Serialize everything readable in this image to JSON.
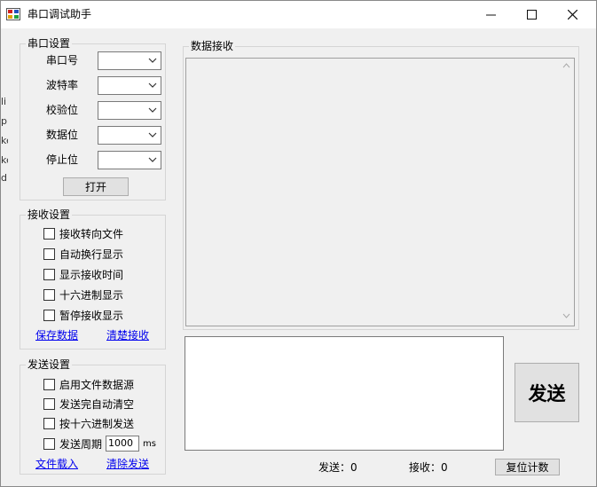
{
  "window": {
    "title": "串口调试助手",
    "minimize_icon": "minimize-icon",
    "maximize_icon": "maximize-icon",
    "close_icon": "close-icon"
  },
  "serial_settings": {
    "title": "串口设置",
    "fields": [
      {
        "label": "串口号",
        "value": ""
      },
      {
        "label": "波特率",
        "value": ""
      },
      {
        "label": "校验位",
        "value": ""
      },
      {
        "label": "数据位",
        "value": ""
      },
      {
        "label": "停止位",
        "value": ""
      }
    ],
    "open_button": "打开"
  },
  "receive_settings": {
    "title": "接收设置",
    "options": [
      {
        "label": "接收转向文件",
        "checked": false
      },
      {
        "label": "自动换行显示",
        "checked": false
      },
      {
        "label": "显示接收时间",
        "checked": false
      },
      {
        "label": "十六进制显示",
        "checked": false
      },
      {
        "label": "暂停接收显示",
        "checked": false
      }
    ],
    "save_data": "保存数据",
    "clear_receive": "清楚接收"
  },
  "send_settings": {
    "title": "发送设置",
    "options": [
      {
        "label": "启用文件数据源",
        "checked": false
      },
      {
        "label": "发送完自动清空",
        "checked": false
      },
      {
        "label": "按十六进制发送",
        "checked": false
      }
    ],
    "period": {
      "label": "发送周期",
      "value": "1000",
      "unit": "ms",
      "checked": false
    },
    "load_file": "文件载入",
    "clear_send": "清除发送"
  },
  "data_receive": {
    "title": "数据接收",
    "content": ""
  },
  "send_area": {
    "content": "",
    "send_button": "发送"
  },
  "status": {
    "sent_label": "发送：0",
    "received_label": "接收：0",
    "reset_button": "复位计数"
  },
  "left_artifacts": [
    "li",
    "p",
    "ke",
    "ke",
    "dl"
  ]
}
